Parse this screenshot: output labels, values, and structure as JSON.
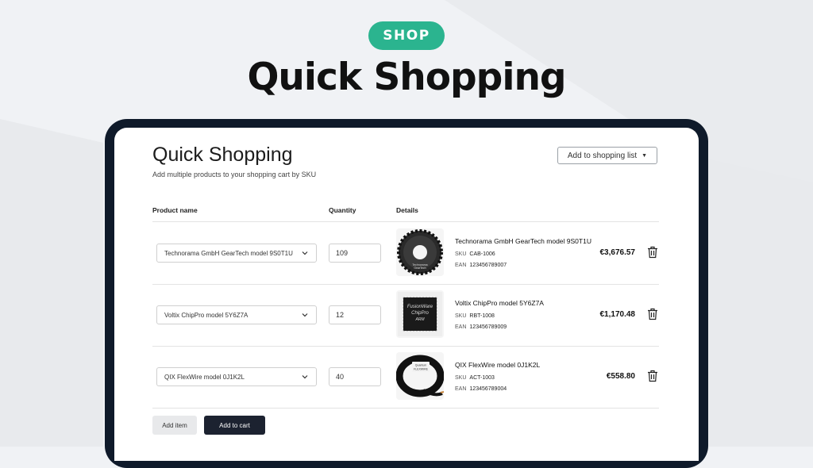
{
  "hero": {
    "badge": "SHOP",
    "title": "Quick Shopping"
  },
  "page": {
    "title": "Quick Shopping",
    "subtitle": "Add multiple products to your shopping cart by SKU",
    "list_button": "Add to shopping list"
  },
  "table": {
    "headers": [
      "Product name",
      "Quantity",
      "Details"
    ],
    "rows": [
      {
        "select": "Technorama GmbH GearTech model 9S0T1U",
        "qty": "109",
        "name": "Technorama GmbH GearTech model 9S0T1U",
        "sku_label": "SKU",
        "sku": "CAB-1006",
        "ean_label": "EAN",
        "ean": "123456789007",
        "price": "€3,676.57"
      },
      {
        "select": "Voltix ChipPro model 5Y6Z7A",
        "qty": "12",
        "name": "Voltix ChipPro model 5Y6Z7A",
        "sku_label": "SKU",
        "sku": "RBT-1008",
        "ean_label": "EAN",
        "ean": "123456789009",
        "price": "€1,170.48"
      },
      {
        "select": "QIX FlexWire model 0J1K2L",
        "qty": "40",
        "name": "QIX FlexWire model 0J1K2L",
        "sku_label": "SKU",
        "sku": "ACT-1003",
        "ean_label": "EAN",
        "ean": "123456789004",
        "price": "€558.80"
      }
    ]
  },
  "thumbs": {
    "gear": [
      "Technorama",
      "GearTech"
    ],
    "chip": [
      "FusionWare",
      "ChipPro",
      "ARM"
    ],
    "wire": [
      "Quantum",
      "FLEXWIRE"
    ]
  },
  "actions": {
    "add_item": "Add item",
    "add_to_cart": "Add to cart"
  },
  "colors": {
    "accent": "#2bb48f",
    "device": "#0f1a2a",
    "primary_button": "#1c2230"
  }
}
